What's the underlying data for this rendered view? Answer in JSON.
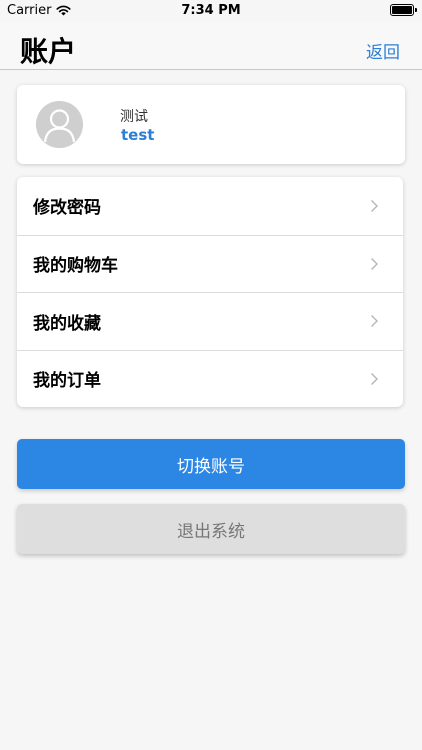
{
  "status_bar": {
    "carrier": "Carrier",
    "time": "7:34 PM",
    "battery_level": 1.0
  },
  "nav": {
    "title": "账户",
    "back_label": "返回"
  },
  "profile": {
    "name": "测试",
    "username": "test",
    "avatar_icon": "person-icon"
  },
  "menu": {
    "items": [
      {
        "label": "修改密码",
        "icon": "chevron-right-icon"
      },
      {
        "label": "我的购物车",
        "icon": "chevron-right-icon"
      },
      {
        "label": "我的收藏",
        "icon": "chevron-right-icon"
      },
      {
        "label": "我的订单",
        "icon": "chevron-right-icon"
      }
    ]
  },
  "actions": {
    "switch_account_label": "切换账号",
    "logout_label": "退出系统"
  },
  "colors": {
    "accent": "#2c86e4",
    "link": "#2b7fd4",
    "disabled_button": "#dedede"
  }
}
